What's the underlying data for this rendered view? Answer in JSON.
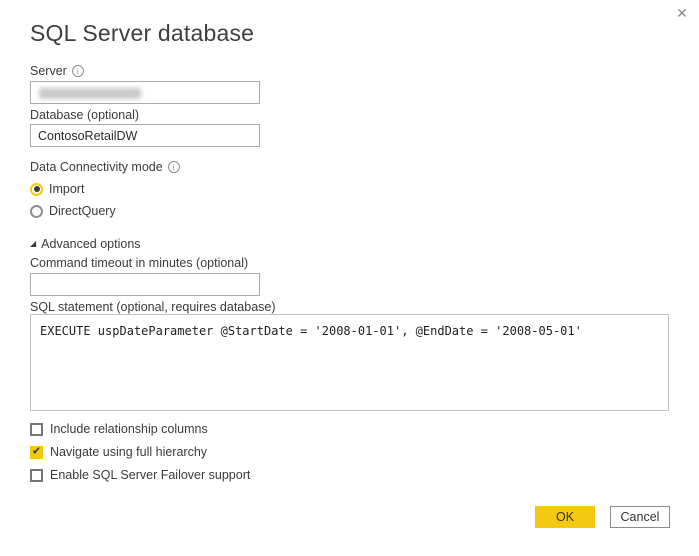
{
  "dialog": {
    "title": "SQL Server database",
    "close_icon": "✕"
  },
  "colors": {
    "accent_yellow": "#F2C811",
    "text_dark": "#3B3B3B",
    "input_border": "#ABABAB"
  },
  "fields": {
    "server": {
      "label": "Server",
      "value": "",
      "redacted": true,
      "info_icon": "i"
    },
    "database": {
      "label": "Database (optional)",
      "value": "ContosoRetailDW"
    },
    "connectivity": {
      "label": "Data Connectivity mode",
      "info_icon": "i",
      "options": [
        {
          "label": "Import",
          "selected": true
        },
        {
          "label": "DirectQuery",
          "selected": false
        }
      ]
    },
    "advanced": {
      "label": "Advanced options",
      "expanded": true,
      "expander_icon": "◢",
      "command_timeout": {
        "label": "Command timeout in minutes (optional)",
        "value": ""
      },
      "sql_statement": {
        "label": "SQL statement (optional, requires database)",
        "value": "EXECUTE uspDateParameter @StartDate = '2008-01-01', @EndDate = '2008-05-01'"
      }
    },
    "checkboxes": [
      {
        "label": "Include relationship columns",
        "checked": false,
        "check_icon": ""
      },
      {
        "label": "Navigate using full hierarchy",
        "checked": true,
        "check_icon": "✔"
      },
      {
        "label": "Enable SQL Server Failover support",
        "checked": false,
        "check_icon": ""
      }
    ]
  },
  "buttons": {
    "ok": "OK",
    "cancel": "Cancel"
  }
}
